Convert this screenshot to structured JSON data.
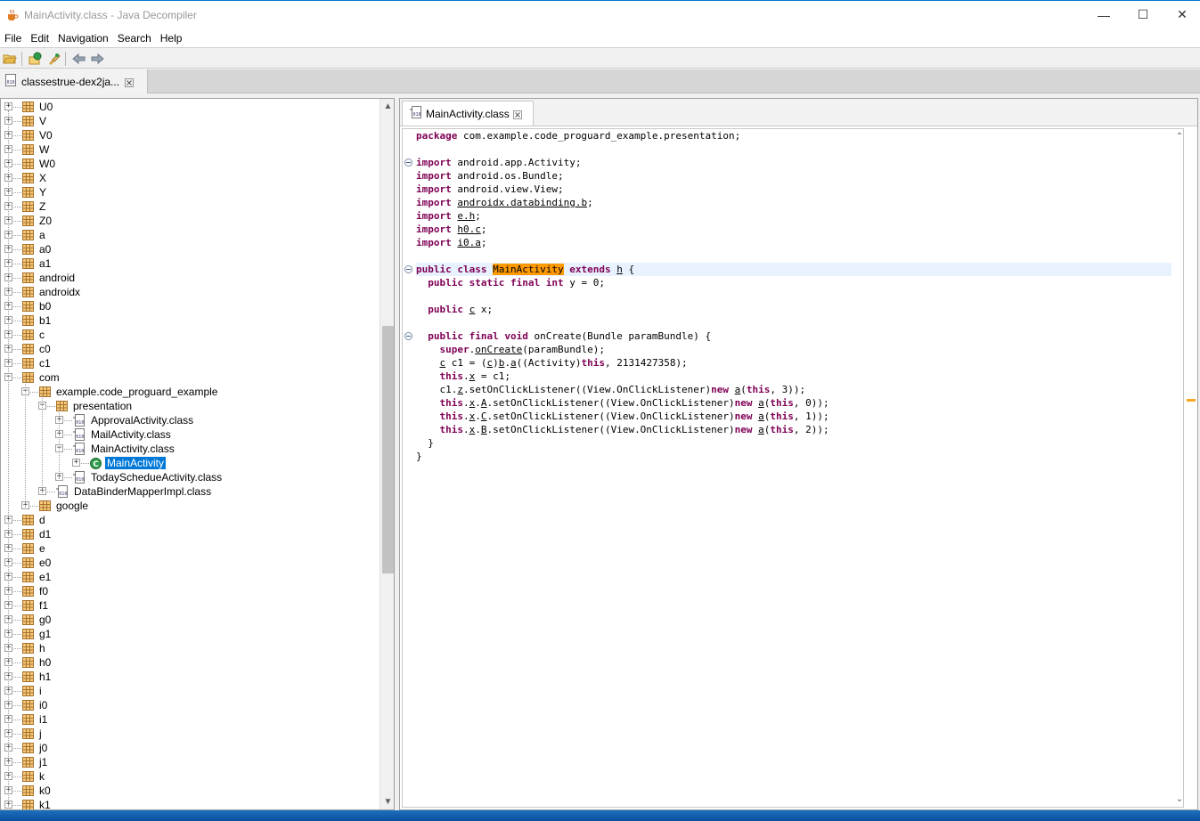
{
  "window": {
    "title": "MainActivity.class - Java Decompiler",
    "minimize": "—",
    "maximize": "☐",
    "close": "✕"
  },
  "menu": [
    "File",
    "Edit",
    "Navigation",
    "Search",
    "Help"
  ],
  "toolbar": {
    "icons": [
      "open-file-icon",
      "open-type-icon",
      "open-type-hierarchy-icon",
      "back-icon",
      "forward-icon"
    ]
  },
  "file_tab": {
    "label": "classestrue-dex2ja..."
  },
  "tree": {
    "top_items": [
      "U0",
      "V",
      "V0",
      "W",
      "W0",
      "X",
      "Y",
      "Z",
      "Z0",
      "a",
      "a0",
      "a1",
      "android",
      "androidx",
      "b0",
      "b1",
      "c",
      "c0",
      "c1"
    ],
    "com": "com",
    "example": "example.code_proguard_example",
    "presentation": "presentation",
    "classes": [
      "ApprovalActivity.class",
      "MailActivity.class",
      "MainActivity.class"
    ],
    "main_activity_node": "MainActivity",
    "today": "TodaySchedueActivity.class",
    "databinder": "DataBinderMapperImpl.class",
    "google": "google",
    "bottom_items": [
      "d",
      "d1",
      "e",
      "e0",
      "e1",
      "f0",
      "f1",
      "g0",
      "g1",
      "h",
      "h0",
      "h1",
      "i",
      "i0",
      "i1",
      "j",
      "j0",
      "j1",
      "k",
      "k0",
      "k1"
    ]
  },
  "editor": {
    "tab_label": "MainActivity.class",
    "code": {
      "package": "com.example.code_proguard_example.presentation;",
      "imports": [
        "android.app.Activity;",
        "android.os.Bundle;",
        "android.view.View;",
        "androidx.databinding.b",
        "e.h",
        "h0.c",
        "i0.a"
      ],
      "class_name": "MainActivity",
      "superclass": "h",
      "field_y": " y = 0;",
      "field_x_type": "c",
      "field_x": " x;",
      "method_sig": " onCreate(Bundle paramBundle) {",
      "super_call_args": "(paramBundle);",
      "c1_line_rest": "((Activity)",
      "c1_line_num": ", 2131427358);",
      "this_x_assign": " = c1;",
      "listener_lines": [
        {
          "prefix": "c1.",
          "field": "z",
          "arg": "3"
        },
        {
          "prefix": "this.x.",
          "field": "A",
          "arg": "0"
        },
        {
          "prefix": "this.x.",
          "field": "C",
          "arg": "1"
        },
        {
          "prefix": "this.x.",
          "field": "B",
          "arg": "2"
        }
      ]
    }
  },
  "colors": {
    "keyword": "#7f0055",
    "highlight": "#ff9900",
    "selection": "#0078d7"
  }
}
